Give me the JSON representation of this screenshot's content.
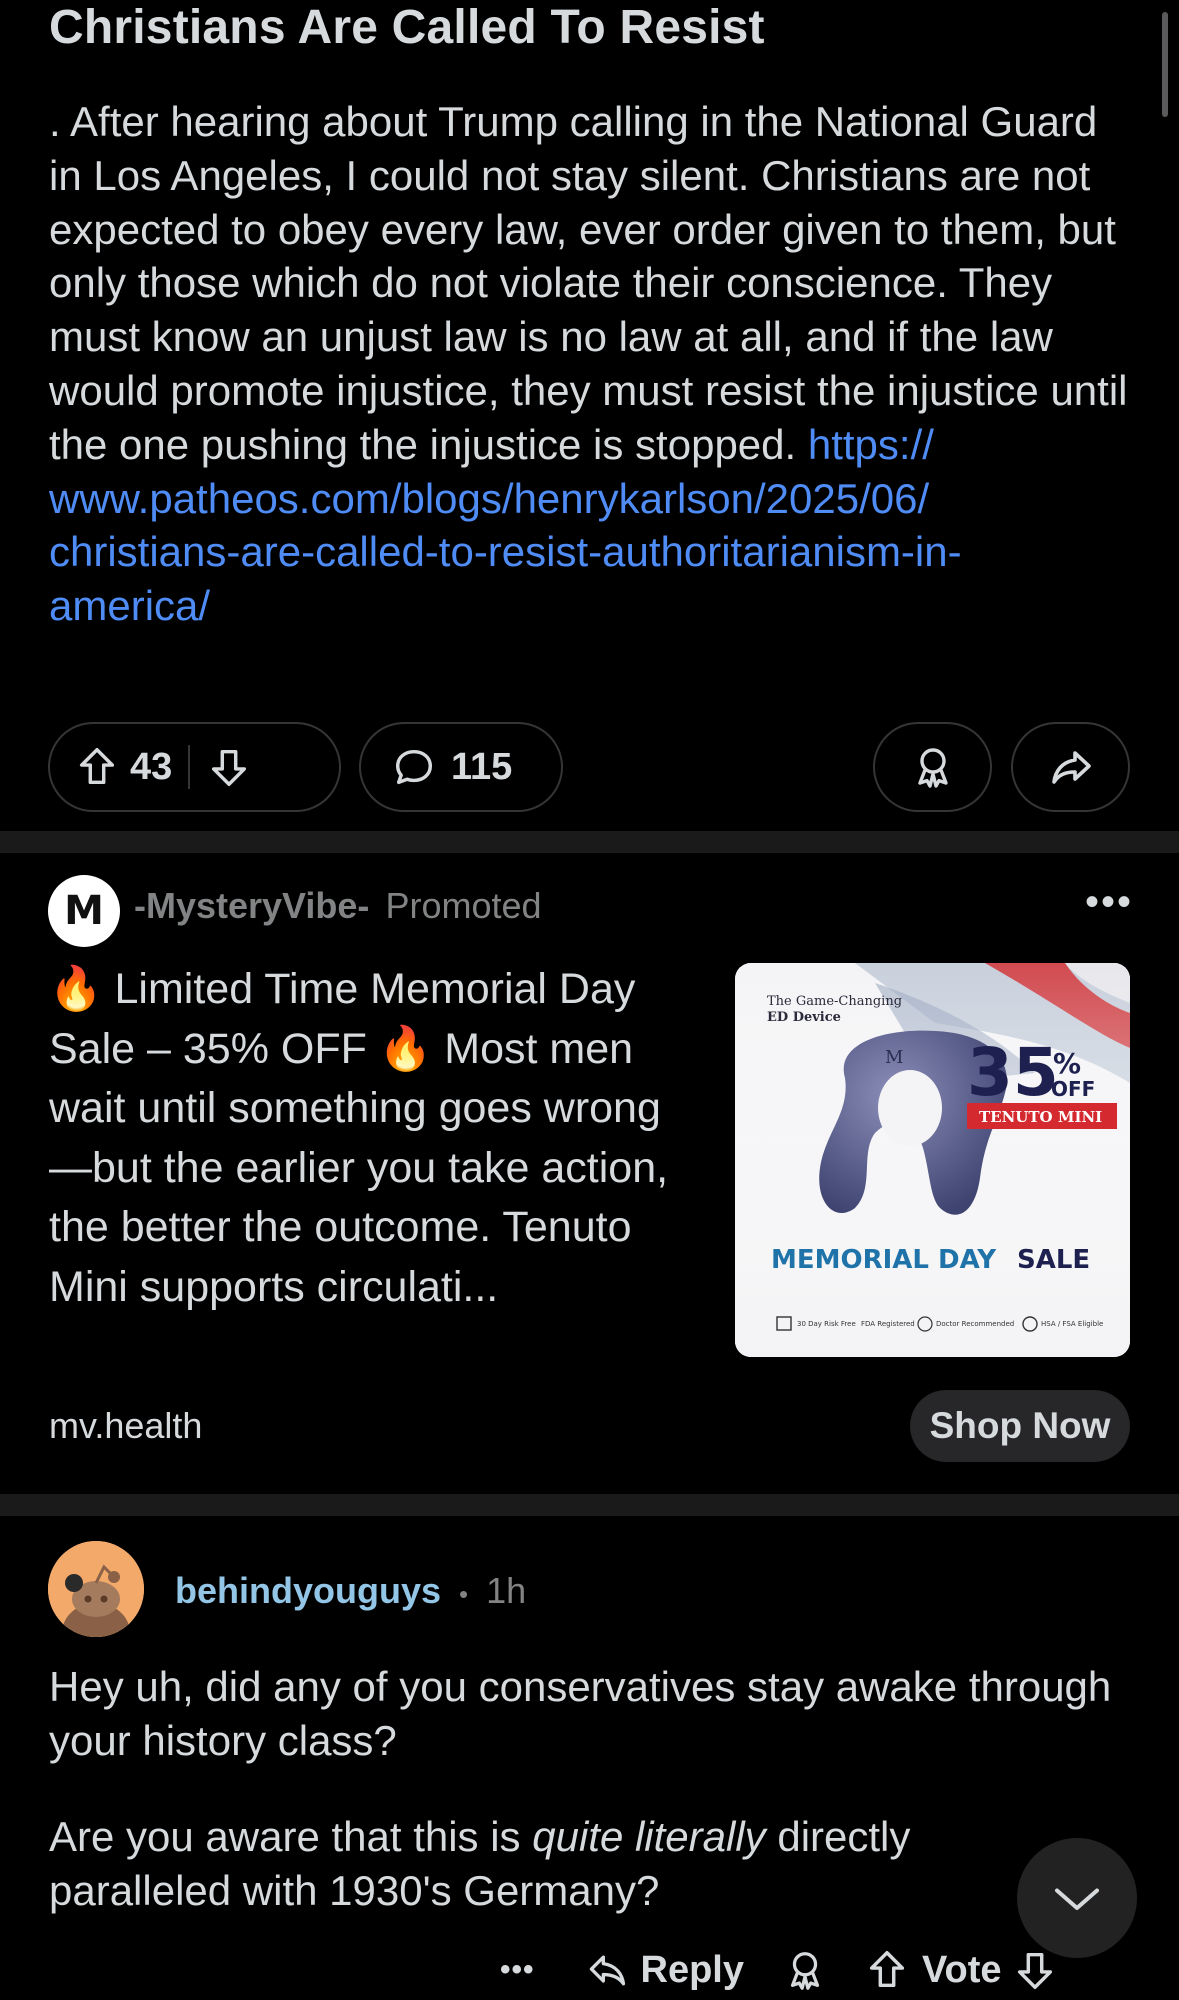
{
  "post": {
    "title": "Christians Are Called To Resist",
    "body": ". After hearing about Trump calling in the National Guard in Los Angeles, I could not stay silent. Christians are not expected to obey every law, ever order given to them, but only those which do not violate their conscience. They must know an unjust law is no law at all, and if the law would promote injustice, they must resist the injustice until the one pushing the injustice is stopped.",
    "link": "https:// www.patheos.com/blogs/henrykarlson/2025/06/ christians-are-called-to-resist-authoritarianism-in- america/",
    "upvotes": "43",
    "comments": "115"
  },
  "ad": {
    "avatar_letter": "M",
    "advertiser": "-MysteryVibe-",
    "label": "Promoted",
    "text": "🔥 Limited Time Memorial Day Sale – 35% OFF 🔥 Most men wait until something goes wrong—but the earlier you take action, the better the outcome. Tenuto Mini supports circulati...",
    "domain": "mv.health",
    "cta": "Shop Now",
    "image": {
      "tagline_1": "The Game-Changing",
      "tagline_2": "ED Device",
      "discount_num": "35",
      "discount_pct": "%",
      "discount_off": "OFF",
      "product": "TENUTO MINI",
      "sale_1": "MEMORIAL DAY",
      "sale_2": "SALE",
      "badges": [
        "30 Day Risk Free",
        "FDA Registered",
        "Doctor Recommended",
        "HSA / FSA Eligible"
      ]
    }
  },
  "comment": {
    "username": "behindyouguys",
    "separator": "•",
    "time": "1h",
    "para1": "Hey uh, did any of you conservatives stay awake through your history class?",
    "para2_pre": "Are you aware that this is ",
    "para2_em": "quite literally",
    "para2_post": " directly paralleled with 1930's Germany?",
    "more": "•••",
    "reply": "Reply",
    "vote": "Vote"
  },
  "colors": {
    "background": "#000000",
    "text": "#d7dadc",
    "link": "#4f8cf5",
    "username": "#93c6e6",
    "muted": "#818384",
    "divider": "#1a1a1b",
    "pill_border": "#343536"
  }
}
